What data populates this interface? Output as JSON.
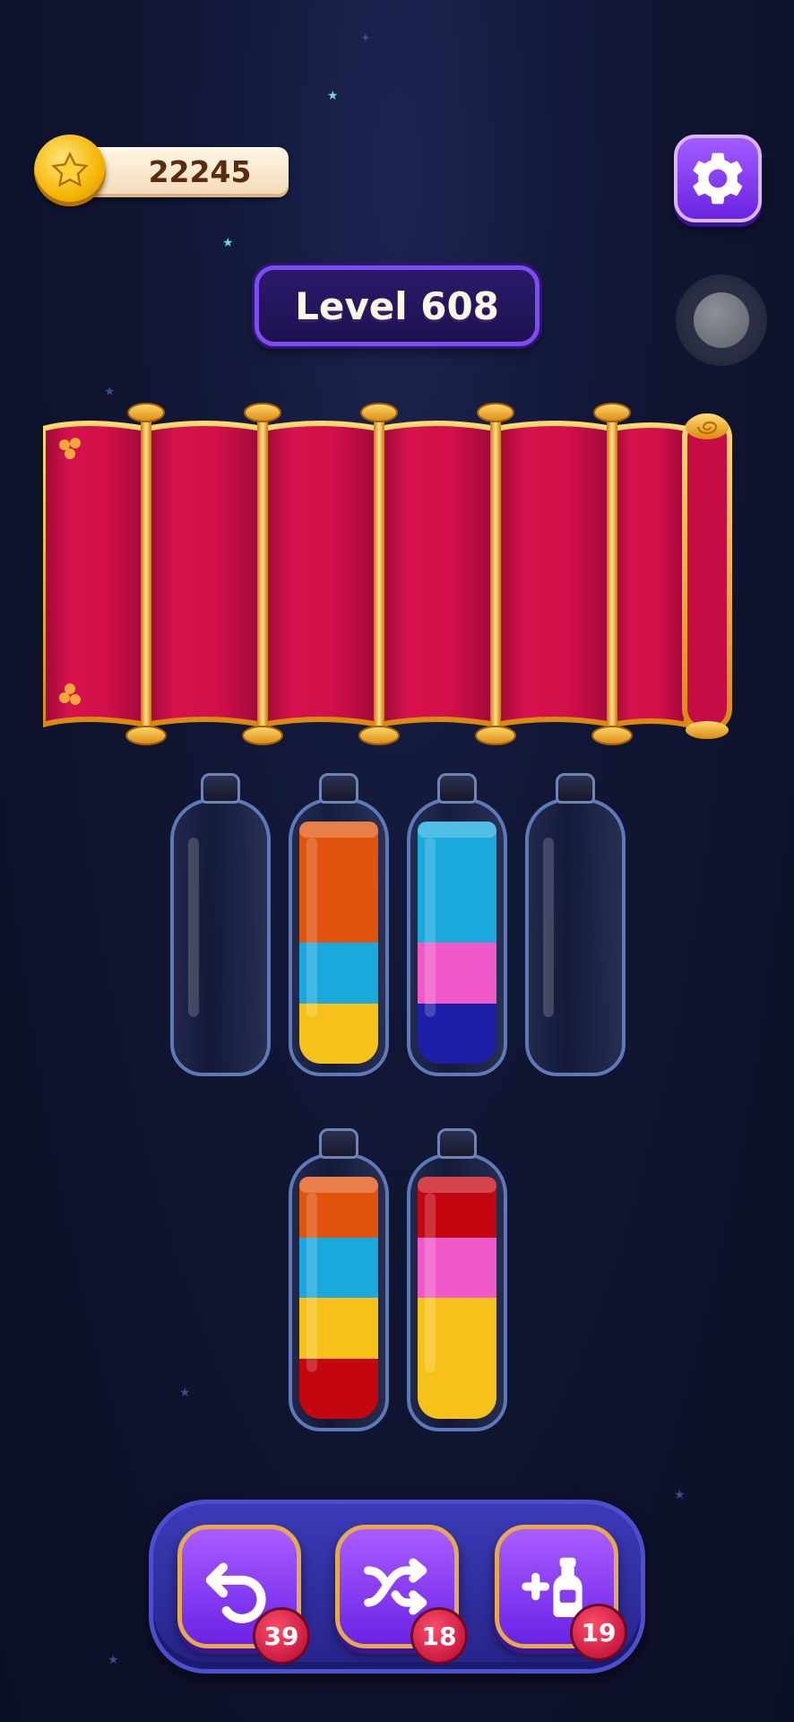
{
  "hud": {
    "coins": "22245",
    "level": "Level 608"
  },
  "icons": {
    "coin": "star-coin-icon",
    "settings": "gear-icon",
    "undo": "undo-icon",
    "shuffle": "shuffle-icon",
    "add_bottle": "add-bottle-icon"
  },
  "colors": {
    "orange": "#e0530c",
    "cyan": "#1aa9dc",
    "yellow": "#f6c21a",
    "red": "#c4060f",
    "pink": "#f05ac8",
    "navy": "#1b1fa8"
  },
  "bottles_row1": [
    {
      "layers": []
    },
    {
      "layers": [
        "yellow",
        "cyan",
        "orange",
        "orange"
      ]
    },
    {
      "layers": [
        "navy",
        "pink",
        "cyan",
        "cyan"
      ]
    },
    {
      "layers": []
    }
  ],
  "bottles_row2": [
    {
      "layers": [
        "red",
        "yellow",
        "cyan",
        "orange"
      ]
    },
    {
      "layers": [
        "yellow",
        "yellow",
        "pink",
        "red"
      ]
    }
  ],
  "toolbar": {
    "undo_count": "39",
    "shuffle_count": "18",
    "add_bottle_count": "19"
  }
}
